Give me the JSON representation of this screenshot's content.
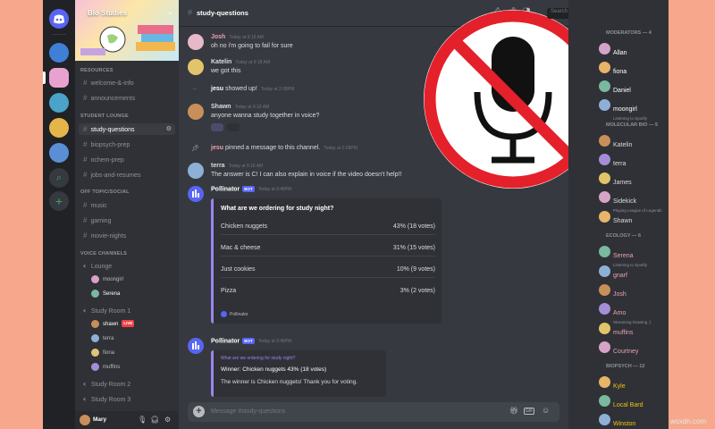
{
  "server": {
    "name": "Bio Studies"
  },
  "channels": {
    "categories": [
      "RESOURCES",
      "STUDENT LOUNGE",
      "OFF TOPIC/SOCIAL",
      "VOICE CHANNELS"
    ],
    "resources": [
      "welcome-&-info",
      "announcements"
    ],
    "lounge": [
      "study-questions",
      "biopsych-prep",
      "ochem-prep",
      "jobs-and-resumes"
    ],
    "social": [
      "music",
      "gaming",
      "movie-nights"
    ],
    "voice": [
      {
        "name": "Lounge"
      },
      {
        "name": "Study Room 1"
      },
      {
        "name": "Study Room 2"
      },
      {
        "name": "Study Room 3"
      }
    ],
    "lounge_users": [
      "moongirl",
      "Serena"
    ],
    "room1_users": [
      "shawn",
      "terra",
      "fiona",
      "muffins"
    ],
    "live_label": "LIVE"
  },
  "user_panel": {
    "name": "Mary"
  },
  "chat": {
    "channel_title": "study-questions",
    "search_placeholder": "Search",
    "messages": [
      {
        "author": "Josh",
        "time": "Today at 9:16 AM",
        "text": "oh no i'm going to fail for sure"
      },
      {
        "author": "Katelin",
        "time": "Today at 9:18 AM",
        "text": "we got this"
      },
      {
        "author": "Shawn",
        "time": "Today at 9:18 AM",
        "text": "anyone wanna study together in voice?"
      },
      {
        "author": "terra",
        "time": "Today at 9:18 AM",
        "text": "The answer is C! I can also explain in voice if the video doesn't help!!"
      }
    ],
    "system": [
      {
        "user": "jesu",
        "text": "showed up!",
        "time": "Today at 2:28PM"
      },
      {
        "user": "jesu",
        "text": "pinned a message to this channel.",
        "time": "Today at 2:28PM"
      }
    ],
    "bot": {
      "name": "Pollinator",
      "badge": "BOT",
      "time": "Today at 9:46PM"
    },
    "poll": {
      "title": "What are we ordering for study night?",
      "options": [
        {
          "label": "Chicken nuggets",
          "votes": "43% (18 votes)"
        },
        {
          "label": "Mac & cheese",
          "votes": "31% (15 votes)"
        },
        {
          "label": "Just cookies",
          "votes": "10% (9 votes)"
        },
        {
          "label": "Pizza",
          "votes": "3% (2 votes)"
        }
      ],
      "footer": "Pollinator"
    },
    "result": {
      "question": "What are we ordering for study night?",
      "winner": "Winner: Chicken nuggets 43% (18 votes)",
      "thanks": "The winner is Chicken nuggets! Thank you for voting."
    },
    "input_placeholder": "Message #study-questions"
  },
  "members": {
    "groups": [
      {
        "title": "MODERATORS — 4",
        "members": [
          {
            "name": "Allan",
            "activity": "",
            "color": "#ffffff"
          },
          {
            "name": "fiona",
            "activity": "",
            "color": "#ffffff"
          },
          {
            "name": "Daniel",
            "activity": "",
            "color": "#ffffff"
          },
          {
            "name": "moongirl",
            "activity": "Listening to Spotify",
            "color": "#ffffff"
          }
        ]
      },
      {
        "title": "MOLECULAR BIO — 5",
        "members": [
          {
            "name": "Katelin",
            "activity": "",
            "color": "#dcddde"
          },
          {
            "name": "terra",
            "activity": "",
            "color": "#dcddde"
          },
          {
            "name": "James",
            "activity": "",
            "color": "#dcddde"
          },
          {
            "name": "Sidekick",
            "activity": "Playing League of Legends",
            "color": "#dcddde"
          },
          {
            "name": "Shawn",
            "activity": "",
            "color": "#dcddde"
          }
        ]
      },
      {
        "title": "ECOLOGY — 6",
        "members": [
          {
            "name": "Serena",
            "activity": "Listening to Spotify",
            "color": "#e9a1b0"
          },
          {
            "name": "gnarf",
            "activity": "",
            "color": "#e9a1b0"
          },
          {
            "name": "Josh",
            "activity": "",
            "color": "#e9a1b0"
          },
          {
            "name": "Amo",
            "activity": "Streaming Drawing :)",
            "color": "#e9a1b0"
          },
          {
            "name": "muffins",
            "activity": "",
            "color": "#e9a1b0"
          },
          {
            "name": "Courtney",
            "activity": "",
            "color": "#e9a1b0"
          }
        ]
      },
      {
        "title": "BIOPSYCH — 12",
        "members": [
          {
            "name": "Kyle",
            "activity": "",
            "color": "#f1c40f"
          },
          {
            "name": "Local Bard",
            "activity": "",
            "color": "#f1c40f"
          },
          {
            "name": "Winston",
            "activity": "",
            "color": "#f1c40f"
          }
        ]
      }
    ]
  },
  "colors": {
    "accent": "#5865f2",
    "no_sign": "#e4202a",
    "poll_bar": "#9b84ec"
  },
  "icons": [
    "discord-icon",
    "hash-icon",
    "speaker-icon",
    "mic-icon",
    "headphones-icon",
    "gear-icon",
    "bell-icon",
    "pin-icon",
    "members-icon",
    "download-icon",
    "mention-icon",
    "help-icon",
    "plus-icon",
    "gift-icon",
    "gif-icon",
    "emoji-icon",
    "no-mic-icon"
  ],
  "watermark": "wsxdn.com"
}
